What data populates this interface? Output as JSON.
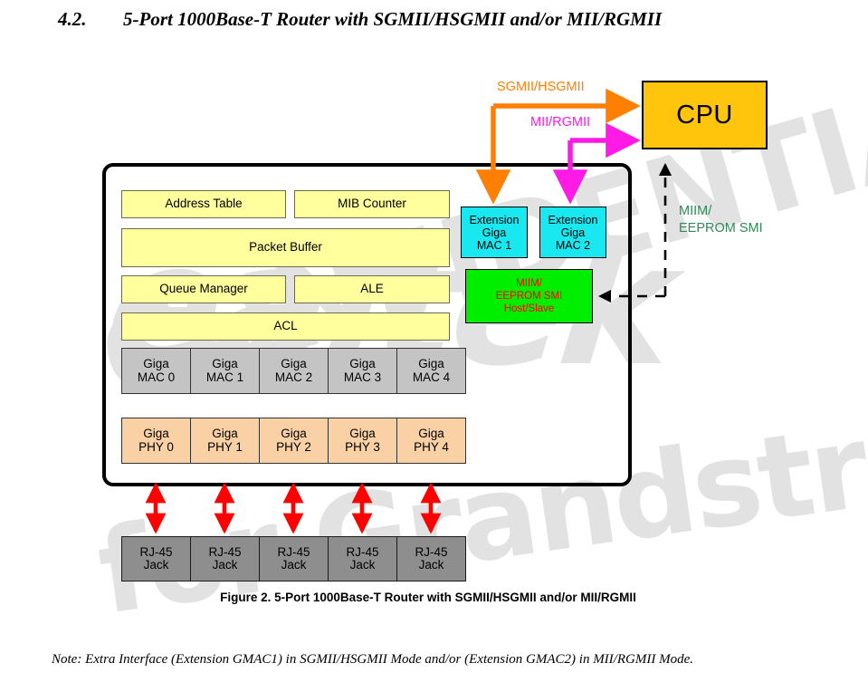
{
  "heading": {
    "number": "4.2.",
    "text": "5-Port 1000Base-T Router with SGMII/HSGMII and/or MII/RGMII"
  },
  "watermark": {
    "brand": "ealtek",
    "confidential": "CONFIDENTIAL",
    "licensee": "for Grandstream"
  },
  "diagram": {
    "cpu_label": "CPU",
    "arrow_labels": {
      "sgmii": "SGMII/HSGMII",
      "mii": "MII/RGMII",
      "miim": "MIIM/\nEEPROM SMI"
    },
    "logic_blocks": [
      {
        "label": "Address Table"
      },
      {
        "label": "MIB Counter"
      },
      {
        "label": "Packet Buffer"
      },
      {
        "label": "Queue Manager"
      },
      {
        "label": "ALE"
      },
      {
        "label": "ACL"
      }
    ],
    "extension_macs": [
      {
        "label": "Extension\nGiga\nMAC 1"
      },
      {
        "label": "Extension\nGiga\nMAC 2"
      }
    ],
    "miim_block": {
      "label": "MIIM/\nEEPROM SMI\nHost/Slave"
    },
    "giga_macs": [
      {
        "label": "Giga\nMAC 0"
      },
      {
        "label": "Giga\nMAC 1"
      },
      {
        "label": "Giga\nMAC 2"
      },
      {
        "label": "Giga\nMAC 3"
      },
      {
        "label": "Giga\nMAC 4"
      }
    ],
    "giga_phys": [
      {
        "label": "Giga\nPHY 0"
      },
      {
        "label": "Giga\nPHY 1"
      },
      {
        "label": "Giga\nPHY 2"
      },
      {
        "label": "Giga\nPHY 3"
      },
      {
        "label": "Giga\nPHY 4"
      }
    ],
    "rj45_jacks": [
      {
        "label": "RJ-45\nJack"
      },
      {
        "label": "RJ-45\nJack"
      },
      {
        "label": "RJ-45\nJack"
      },
      {
        "label": "RJ-45\nJack"
      },
      {
        "label": "RJ-45\nJack"
      }
    ],
    "colors": {
      "cpu": "#ffc40c",
      "logic_block": "#ffff9e",
      "giga_mac": "#c4c4c4",
      "giga_phy": "#fad0a5",
      "extension_mac": "#19e8f0",
      "miim": "#00ee00",
      "miim_text": "#ff0000",
      "rj45": "#8e8e8e",
      "sgmii_arrow": "#ff7f00",
      "mii_arrow": "#ff1ae6",
      "port_arrow": "#ff0000",
      "miim_label": "#2e8b57"
    }
  },
  "caption": "Figure 2.   5-Port 1000Base-T Router with SGMII/HSGMII and/or MII/RGMII",
  "note": "Note: Extra Interface (Extension GMAC1) in SGMII/HSGMII Mode and/or (Extension GMAC2) in MII/RGMII Mode."
}
